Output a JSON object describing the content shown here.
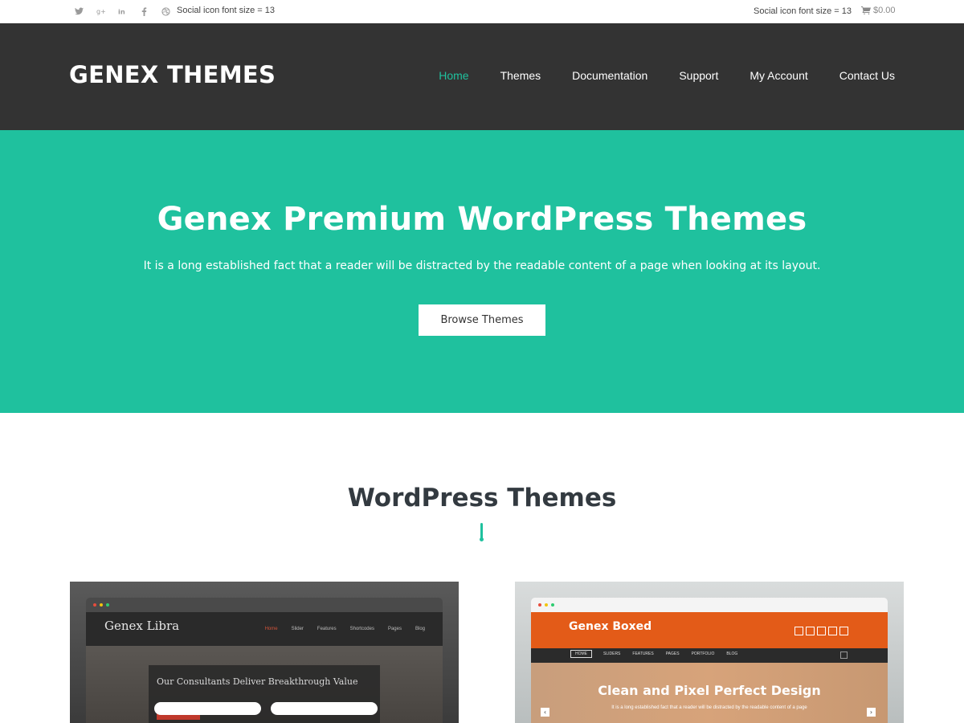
{
  "topbar": {
    "social_icons": [
      "twitter-icon",
      "google-plus-icon",
      "linkedin-icon",
      "facebook-icon",
      "dribbble-icon"
    ],
    "left_text": "Social icon font size = 13",
    "right_text": "Social icon font size = 13",
    "cart_icon": "cart-icon",
    "cart_amount": "$0.00"
  },
  "header": {
    "logo": "GENEX THEMES",
    "nav": [
      {
        "label": "Home",
        "active": true
      },
      {
        "label": "Themes"
      },
      {
        "label": "Documentation"
      },
      {
        "label": "Support"
      },
      {
        "label": "My Account"
      },
      {
        "label": "Contact Us"
      }
    ]
  },
  "hero": {
    "title": "Genex Premium WordPress Themes",
    "subtitle": "It is a long established fact that a reader will be distracted by the readable content of a page when looking at its layout.",
    "button": "Browse Themes"
  },
  "section": {
    "title": "WordPress Themes"
  },
  "themes": [
    {
      "name": "Genex Libra",
      "nav": [
        "Home",
        "Slider",
        "Features",
        "Shortcodes",
        "Pages",
        "Blog"
      ],
      "headline": "Our Consultants Deliver Breakthrough Value"
    },
    {
      "name": "Genex Boxed",
      "nav": [
        "HOME",
        "SLIDERS",
        "FEATURES",
        "PAGES",
        "PORTFOLIO",
        "BLOG"
      ],
      "headline": "Clean and Pixel Perfect Design",
      "text": "It is a long established fact that a reader will be distracted by the readable content of a page"
    }
  ],
  "colors": {
    "accent": "#1fc19e",
    "header_bg": "#333333",
    "boxed_orange": "#e35b18"
  }
}
